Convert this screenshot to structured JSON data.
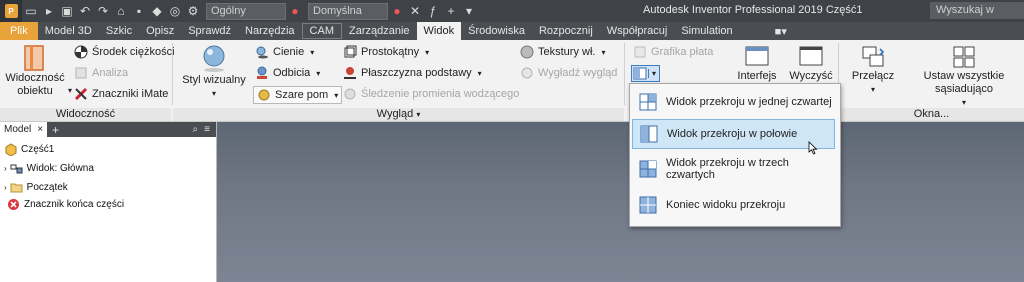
{
  "qat": {
    "appearance": "Ogólny",
    "material": "Domyślna",
    "title": "Autodesk Inventor Professional 2019    Część1",
    "search_placeholder": "Wyszukaj w pomoc"
  },
  "tabs": [
    {
      "label": "Plik"
    },
    {
      "label": "Model 3D"
    },
    {
      "label": "Szkic"
    },
    {
      "label": "Opisz"
    },
    {
      "label": "Sprawdź"
    },
    {
      "label": "Narzędzia"
    },
    {
      "label": "CAM"
    },
    {
      "label": "Zarządzanie"
    },
    {
      "label": "Widok"
    },
    {
      "label": "Środowiska"
    },
    {
      "label": "Rozpocznij"
    },
    {
      "label": "Współpracuj"
    },
    {
      "label": "Simulation"
    }
  ],
  "ribbon": {
    "visibility": {
      "visibility_btn": "Widoczność obiektu",
      "center_gravity": "Środek ciężkości",
      "analysis": "Analiza",
      "imate": "Znaczniki iMate",
      "title": "Widoczność"
    },
    "appearance": {
      "visual_style": "Styl wizualny",
      "shadows": "Cienie",
      "reflections": "Odbicia",
      "gray": "Szare pom",
      "rect": "Prostokątny",
      "ground_plane": "Płaszczyzna podstawy",
      "ray_tracing": "Śledzenie promienia wodzącego",
      "textures": "Tekstury wł.",
      "smooth": "Wygładź wygląd",
      "title": "Wygląd"
    },
    "window": {
      "flat_graphics": "Grafika płata",
      "ui": "Interfejs",
      "clean": "Wyczyść",
      "switch": "Przełącz",
      "arrange": "Ustaw wszystkie sąsiadująco",
      "title": "Okna..."
    }
  },
  "browser": {
    "tab": "Model",
    "items": [
      {
        "label": "Część1"
      },
      {
        "label": "Widok: Główna"
      },
      {
        "label": "Początek"
      },
      {
        "label": "Znacznik końca części"
      }
    ]
  },
  "dropdown": {
    "items": [
      {
        "label": "Widok przekroju w jednej czwartej"
      },
      {
        "label": "Widok przekroju w połowie"
      },
      {
        "label": "Widok przekroju w trzech czwartych"
      },
      {
        "label": "Koniec widoku przekroju"
      }
    ]
  }
}
